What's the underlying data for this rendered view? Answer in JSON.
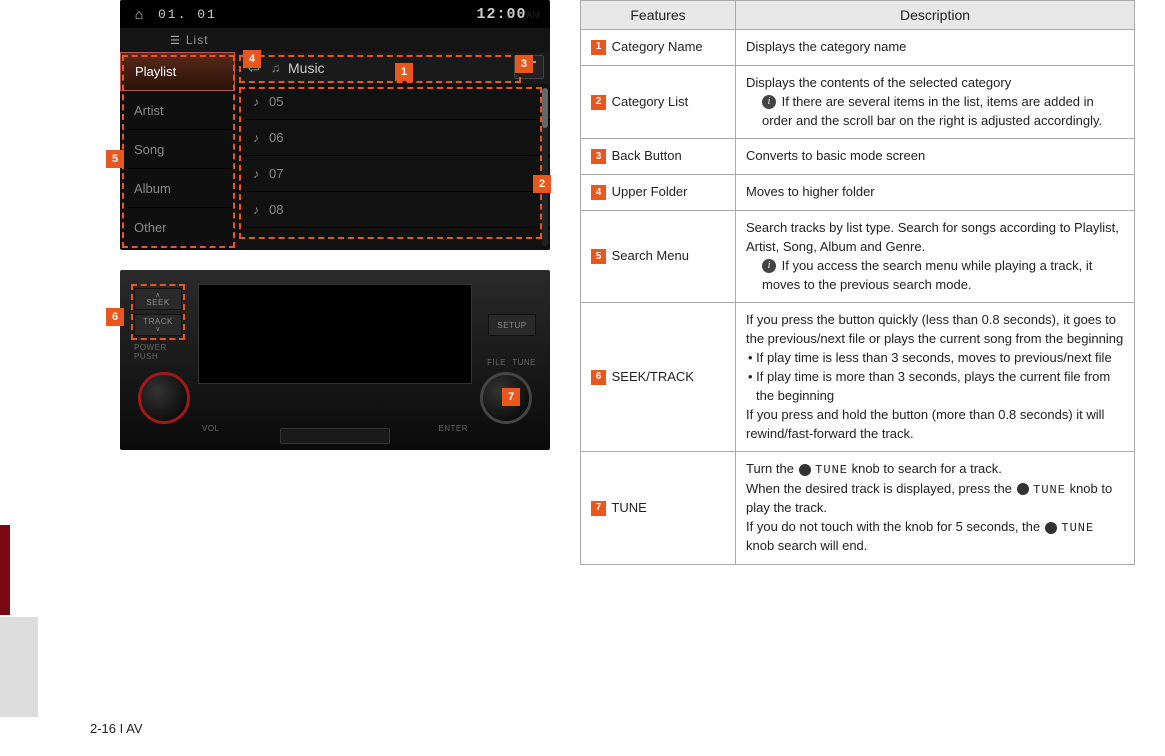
{
  "screen1": {
    "date": "01. 01",
    "time": "12:00",
    "ampm": "AM",
    "list_label": "List",
    "menu": [
      "Playlist",
      "Artist",
      "Song",
      "Album",
      "Other"
    ],
    "header": "Music",
    "tracks": [
      "05",
      "06",
      "07",
      "08"
    ]
  },
  "hw": {
    "seek": "SEEK",
    "track": "TRACK",
    "power": "POWER\nPUSH",
    "setup": "SETUP",
    "file": "FILE",
    "tune": "TUNE",
    "vol": "VOL",
    "enter": "ENTER"
  },
  "table": {
    "head_features": "Features",
    "head_desc": "Description",
    "rows": [
      {
        "n": "1",
        "name": "Category Name",
        "desc": "Displays the category name"
      },
      {
        "n": "2",
        "name": "Category List",
        "desc_main": "Displays the contents of the selected category",
        "desc_info": "If there are several items in the list, items are added in order and the scroll bar on the right is adjusted accordingly."
      },
      {
        "n": "3",
        "name": "Back Button",
        "desc": "Converts to basic mode screen"
      },
      {
        "n": "4",
        "name": "Upper Folder",
        "desc": "Moves to higher folder"
      },
      {
        "n": "5",
        "name": "Search Menu",
        "desc_main": "Search tracks by list type. Search for songs according to Playlist, Artist, Song, Album and Genre.",
        "desc_info": "If you access the search menu while playing a track, it moves to the previous search mode."
      },
      {
        "n": "6",
        "name": "SEEK/TRACK",
        "desc_main": "If you press the button quickly (less than 0.8 seconds), it goes to the previous/next file or plays the current song from the beginning",
        "b1": "If play time is less than 3 seconds, moves to previous/next file",
        "b2": "If play time is more than 3 seconds, plays the current file from the beginning",
        "desc_after": "If you press and hold the button (more than 0.8 seconds) it will rewind/fast-forward the track."
      },
      {
        "n": "7",
        "name": "TUNE",
        "p1a": "Turn the ",
        "p1b": " knob to search for a track.",
        "p2a": "When the desired track is displayed, press the ",
        "p2b": " knob to play the track.",
        "p3a": "If you do not touch with the knob for 5 seconds, the ",
        "p3b": " knob search will end.",
        "tune_word": "TUNE"
      }
    ]
  },
  "footer": "2-16 I AV"
}
